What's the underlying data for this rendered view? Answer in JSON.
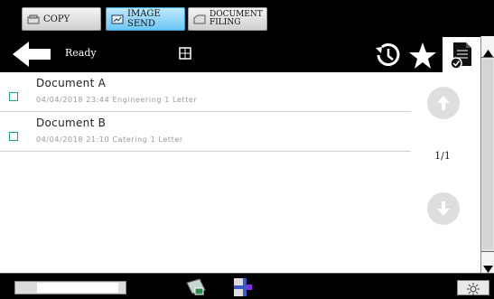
{
  "top_tabs": [
    {
      "label": "COPY",
      "icon": "copy-icon"
    },
    {
      "label": "IMAGE SEND",
      "icon": "image-send-icon"
    },
    {
      "label": "DOCUMENT\nFILING",
      "icon": "document-filing-icon"
    }
  ],
  "header": {
    "status": "Ready",
    "icons": [
      "back-arrow-icon",
      "layout-toggle-icon",
      "history-icon",
      "star-icon",
      "document-icon"
    ]
  },
  "documents": [
    {
      "name": "Document A",
      "meta": "04/04/2018 23:44 Engineering 1 Letter",
      "checked": false
    },
    {
      "name": "Document B",
      "meta": "04/04/2018 21:10 Catering 1 Letter",
      "checked": false
    }
  ],
  "pager": {
    "indicator": "1/1",
    "up_icon": "arrow-up-icon",
    "down_icon": "arrow-down-icon"
  },
  "colors": {
    "accent": "#1fa37a",
    "send_tab": "#6cc6f2",
    "pager_button": "#dedede"
  },
  "bottom": {
    "icons": [
      "job-status-icon",
      "printer-icon",
      "brightness-icon"
    ]
  }
}
